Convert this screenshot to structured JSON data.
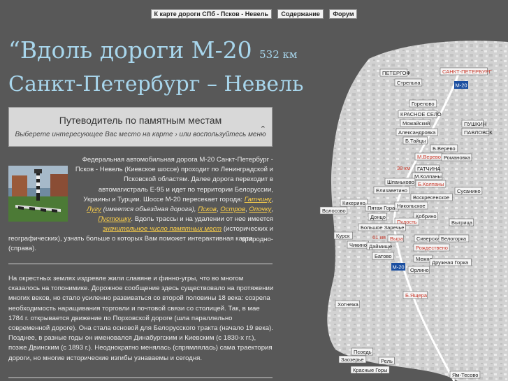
{
  "nav": {
    "link1": "К карте дороги СПб - Псков - Невель",
    "link2": "Содержание",
    "link3": "Форум"
  },
  "title": {
    "line1": "“Вдоль дороги М-20",
    "km": "532 км",
    "line2": "Санкт-Петербург – Невель"
  },
  "guide": {
    "heading": "Путеводитель по памятным местам",
    "sub": "Выберете интересующее Вас место на карте",
    "sub_tail": "или воспользуйтесь меню"
  },
  "intro": {
    "t1": "Федеральная автомобильная дорога М-20 Санкт-Петербург - Псков - Невель (Киевское шоссе) проходит по Ленинградской и Псковской областям. Далее дорога переходит в автомагистраль Е-95 и идет по территории Белоруссии, Украины и Турции. Шоссе М-20 пересекает города: ",
    "gatchina": "Гатчину",
    "comma1": ", ",
    "luga": "Лугу",
    "luga_note": " (имеется объездная дорога), ",
    "pskov": "Псков",
    "comma2": ", ",
    "ostrov": "Остров",
    "comma3": ", ",
    "opochka": "Опочку",
    "comma4": ", ",
    "pustoshka": "Пустошку",
    "t2": ". Вдоль трассы и на удалении от нее имеется ",
    "places_link": "значительное число памятных мест",
    "t3": " (исторических и природно-",
    "t4": "географических), узнать больше о которых Вам поможет интерактивная карта (справа)."
  },
  "history": "На окрестных землях издревле жили славяне и финно-угры, что во многом сказалось на топонимике. Дорожное сообщение здесь существовало на протяжении многих веков, но стало усиленно развиваться со второй половины 18 века: созрела необходимость наращивания торговли и почтовой связи со столицей. Так, в мае 1784 г. открывается движение по Порховской дороге (шла параллельно современной дороге). Она стала основой для Белорусского тракта (начало 19 века). Позднее, в разные годы он именовался Динабургским и Киевским (с 1830-х гг.), позже Двинским (с 1893 г.). Неоднократно менялась (спрямлялась) сама траектория дороги, но многие исторические изгибы узнаваемы и сегодня.",
  "map": {
    "road_labels": [
      "М-20",
      "М-20"
    ],
    "distance_labels": [
      "38 км",
      "61 км"
    ],
    "places": [
      "ПЕТЕРГОФ",
      "САНКТ-ПЕТЕРБУРГ",
      "Стрельна",
      "Горелово",
      "КРАСНОЕ СЕЛО",
      "Можайский",
      "ПУШКИН",
      "Александровка",
      "ПАВЛОВСК",
      "Б.Тайцы",
      "Б.Верево",
      "М.Верево",
      "Романовка",
      "ГАТЧИНА",
      "М.Колпаны",
      "Б.Колпаны",
      "Шпаньково",
      "Елизаветино",
      "Сусанино",
      "Кикерино",
      "Воскресенское",
      "Пятая Гора",
      "Никольское",
      "Волосово",
      "Кобрино",
      "Донцо",
      "Пудость",
      "Выгрица",
      "Большое Заречье",
      "Курск",
      "Чикино",
      "Выра",
      "Сиверский",
      "Белогорка",
      "Даймище",
      "Рождествено",
      "Батово",
      "Межно",
      "Дружная Горка",
      "Орлино",
      "Б.Ящера",
      "Хотнежа",
      "Псоедь",
      "Заозерье",
      "Рель",
      "Красные Горы",
      "Ям-Тесово"
    ],
    "colors": {
      "road": "#1a4ea0",
      "highlight": "#c8392b",
      "land": "#dcdcdc"
    }
  }
}
